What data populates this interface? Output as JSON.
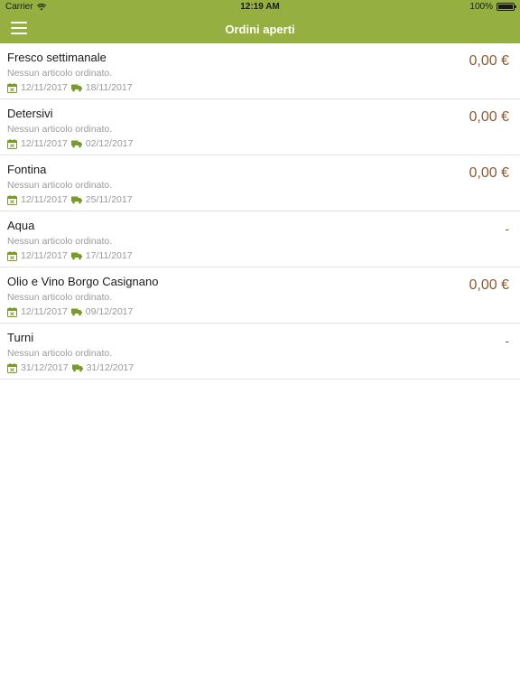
{
  "status_bar": {
    "carrier": "Carrier",
    "time": "12:19 AM",
    "battery": "100%"
  },
  "nav": {
    "title": "Ordini aperti",
    "menu_icon": "hamburger-icon"
  },
  "colors": {
    "header": "#95b040",
    "amount": "#8a5a32",
    "icon": "#7a9a2a"
  },
  "orders": [
    {
      "title": "Fresco settimanale",
      "subtitle": "Nessun articolo ordinato.",
      "open_date": "12/11/2017",
      "delivery_date": "18/11/2017",
      "amount": "0,00 €"
    },
    {
      "title": "Detersivi",
      "subtitle": "Nessun articolo ordinato.",
      "open_date": "12/11/2017",
      "delivery_date": "02/12/2017",
      "amount": "0,00 €"
    },
    {
      "title": "Fontina",
      "subtitle": "Nessun articolo ordinato.",
      "open_date": "12/11/2017",
      "delivery_date": "25/11/2017",
      "amount": "0,00 €"
    },
    {
      "title": "Aqua",
      "subtitle": "Nessun articolo ordinato.",
      "open_date": "12/11/2017",
      "delivery_date": "17/11/2017",
      "amount": "-"
    },
    {
      "title": "Olio e Vino Borgo Casignano",
      "subtitle": "Nessun articolo ordinato.",
      "open_date": "12/11/2017",
      "delivery_date": "09/12/2017",
      "amount": "0,00 €"
    },
    {
      "title": "Turni",
      "subtitle": "Nessun articolo ordinato.",
      "open_date": "31/12/2017",
      "delivery_date": "31/12/2017",
      "amount": "-"
    }
  ]
}
